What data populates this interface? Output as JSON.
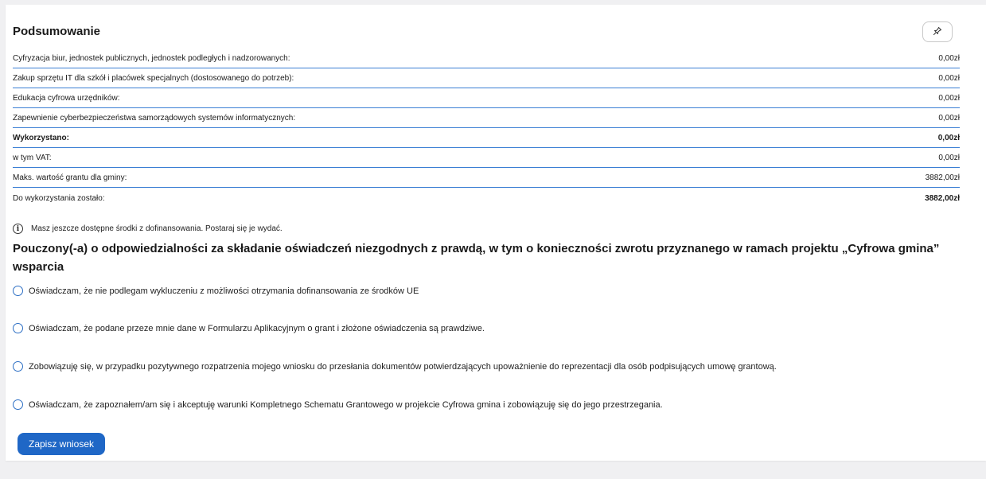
{
  "summary": {
    "title": "Podsumowanie",
    "rows": [
      {
        "label": "Cyfryzacja biur, jednostek publicznych, jednostek podległych i nadzorowanych:",
        "value": "0,00zł"
      },
      {
        "label": "Zakup sprzętu IT dla szkół i placówek specjalnych (dostosowanego do potrzeb):",
        "value": "0,00zł"
      },
      {
        "label": "Edukacja cyfrowa urzędników:",
        "value": "0,00zł"
      },
      {
        "label": "Zapewnienie cyberbezpieczeństwa samorządowych systemów informatycznych:",
        "value": "0,00zł"
      },
      {
        "label": "Wykorzystano:",
        "value": "0,00zł"
      },
      {
        "label": "w tym VAT:",
        "value": "0,00zł"
      },
      {
        "label": "Maks. wartość grantu dla gminy:",
        "value": "3882,00zł"
      },
      {
        "label": "Do wykorzystania zostało:",
        "value": "3882,00zł"
      }
    ],
    "info_icon": "i",
    "info_text": "Masz jeszcze dostępne środki z dofinansowania. Postaraj się je wydać."
  },
  "declaration": {
    "heading": "Pouczony(-a) o odpowiedzialności za składanie oświadczeń niezgodnych z prawdą, w tym o konieczności zwrotu przyznanego w ramach projektu „Cyfrowa gmina” wsparcia",
    "options": [
      "Oświadczam, że nie podlegam wykluczeniu z możliwości otrzymania dofinansowania ze środków UE",
      "Oświadczam, że podane przeze mnie dane w Formularzu Aplikacyjnym o grant i złożone oświadczenia są prawdziwe.",
      "Zobowiązuję się, w przypadku pozytywnego rozpatrzenia mojego wniosku do przesłania dokumentów potwierdzających upoważnienie do reprezentacji dla osób podpisujących umowę grantową.",
      "Oświadczam, że zapoznałem/am się i akceptuję warunki Kompletnego Schematu Grantowego w projekcie Cyfrowa gmina i zobowiązuję się do jego przestrzegania."
    ]
  },
  "actions": {
    "save_label": "Zapisz wniosek"
  },
  "colors": {
    "accent": "#1f67c6",
    "row_divider": "#3b7fd4",
    "radio_border": "#2d6fc4",
    "page_bg": "#f0f0f2"
  },
  "icons": {
    "pin": "pin-icon",
    "info": "info-icon"
  }
}
